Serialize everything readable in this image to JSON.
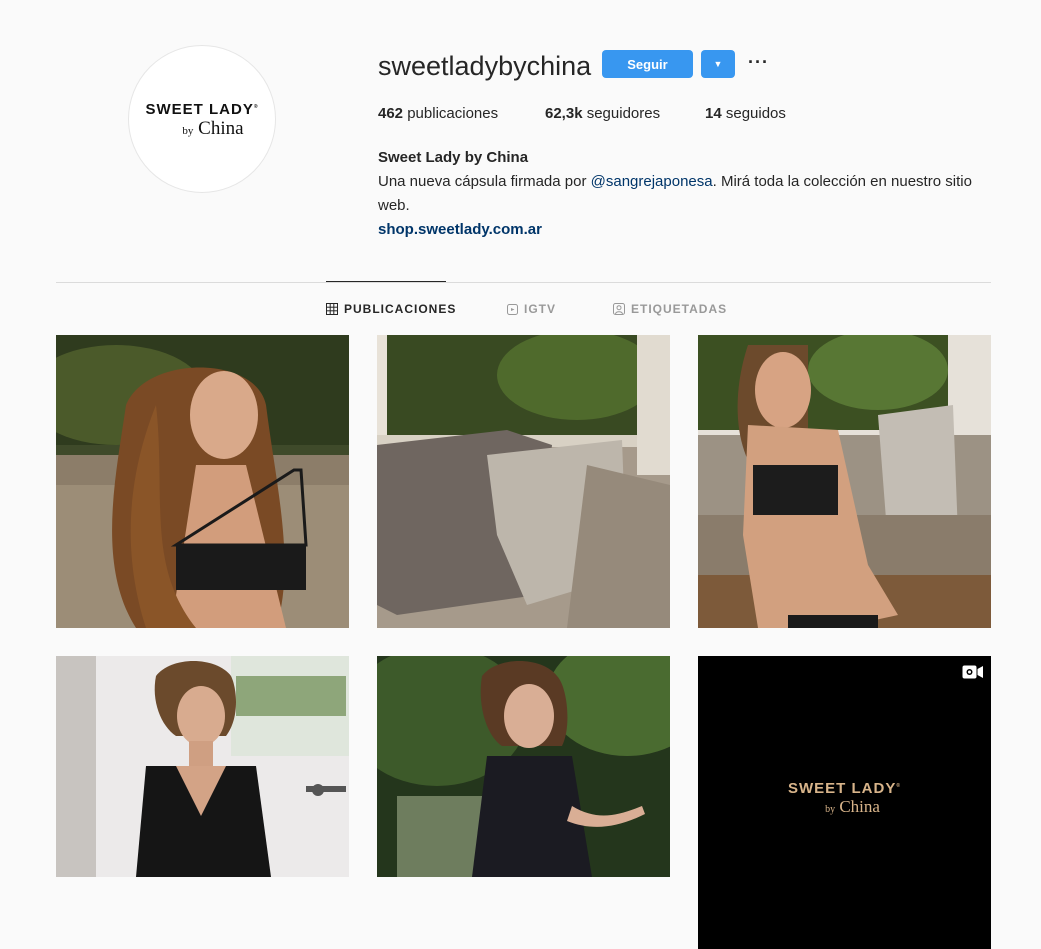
{
  "profile": {
    "username": "sweetladybychina",
    "avatar_logo": {
      "main": "SWEET LADY",
      "mark": "®",
      "by": "by",
      "sub": "China"
    },
    "follow_label": "Seguir",
    "dropdown_icon": "triangle-down-icon",
    "more_icon": "ellipsis-icon",
    "more_label": "···"
  },
  "stats": {
    "posts_count": "462",
    "posts_label": "publicaciones",
    "followers_count": "62,3k",
    "followers_label": "seguidores",
    "following_count": "14",
    "following_label": "seguidos"
  },
  "bio": {
    "name": "Sweet Lady by China",
    "text_before": "Una nueva cápsula firmada por ",
    "mention": "@sangrejaponesa",
    "text_after": ". Mirá toda la colección en nuestro sitio web.",
    "link": "shop.sweetlady.com.ar"
  },
  "tabs": [
    {
      "label": "PUBLICACIONES",
      "icon": "grid-icon",
      "active": true
    },
    {
      "label": "IGTV",
      "icon": "tv-icon",
      "active": false
    },
    {
      "label": "ETIQUETADAS",
      "icon": "tag-person-icon",
      "active": false
    }
  ],
  "posts": [
    {
      "type": "photo"
    },
    {
      "type": "photo"
    },
    {
      "type": "photo"
    },
    {
      "type": "photo"
    },
    {
      "type": "photo"
    },
    {
      "type": "video",
      "icon": "video-camera-icon",
      "overlay_main": "SWEET LADY",
      "overlay_mark": "®",
      "overlay_by": "by",
      "overlay_sub": "China"
    }
  ],
  "colors": {
    "accent": "#3897f0",
    "link": "#003569",
    "text": "#262626",
    "muted": "#999999",
    "background": "#fafafa"
  }
}
